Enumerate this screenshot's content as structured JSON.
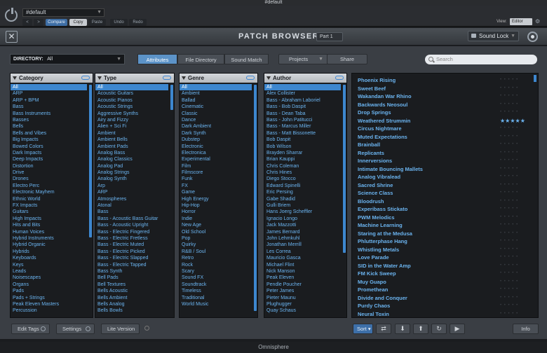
{
  "host": {
    "window_title": "#default",
    "preset_name": "#default",
    "nav_back": "<",
    "nav_forward": ">",
    "buttons": {
      "compare": "Compare",
      "copy": "Copy",
      "paste": "Paste",
      "undo": "Undo",
      "redo": "Redo"
    },
    "view_label": "View:",
    "view_value": "Editor"
  },
  "header": {
    "title": "PATCH BROWSER",
    "part": "Part 1",
    "sound_lock": "Sound Lock"
  },
  "directory": {
    "label": "DIRECTORY:",
    "value": "All"
  },
  "tabs": [
    "Attributes",
    "File Directory",
    "Sound Match"
  ],
  "projects_label": "Projects",
  "share_label": "Share",
  "search_placeholder": "Search",
  "columns": {
    "category": {
      "title": "Category",
      "items": [
        "All",
        "ARP",
        "ARP + BPM",
        "Bass",
        "Bass Instruments",
        "Basses",
        "Bells",
        "Bells and Vibes",
        "Big Impacts",
        "Bowed Colors",
        "Dark Impacts",
        "Deep Impacts",
        "Distortion",
        "Drive",
        "Drones",
        "Electro Perc",
        "Electronic Mayhem",
        "Ethnic World",
        "FX Impacts",
        "Guitars",
        "High Impacts",
        "Hits and Bits",
        "Human Voices",
        "Hybrid Instruments",
        "Hybrid Organic",
        "Hybrids",
        "Keyboards",
        "Keys",
        "Leads",
        "Noisescapes",
        "Organs",
        "Pads",
        "Pads + Strings",
        "Peak Eleven Masters",
        "Percussion"
      ]
    },
    "type": {
      "title": "Type",
      "items": [
        "All",
        "Acoustic Guitars",
        "Acoustic Pianos",
        "Acoustic Strings",
        "Aggressive Synths",
        "Airy and Fizzy",
        "Alien + Sci Fi",
        "Ambient",
        "Ambient Bells",
        "Ambient Pads",
        "Analog Bass",
        "Analog Classics",
        "Analog Pad",
        "Analog Strings",
        "Analog Synth",
        "Arp",
        "ARP",
        "Atmospheres",
        "Atonal",
        "Bass",
        "Bass - Acoustic Bass Guitar",
        "Bass - Acoustic Upright",
        "Bass - Electric Fingered",
        "Bass - Electric Fretless",
        "Bass - Electric Muted",
        "Bass - Electric Picked",
        "Bass - Electric Slapped",
        "Bass - Electric Tapped",
        "Bass Synth",
        "Bell Pads",
        "Bell Textures",
        "Bells Acoustic",
        "Bells Ambient",
        "Bells Analog",
        "Bells Bowls"
      ]
    },
    "genre": {
      "title": "Genre",
      "items": [
        "All",
        "Ambient",
        "Ballad",
        "Cinematic",
        "Classic",
        "Dance",
        "Dark Ambient",
        "Dark Synth",
        "Dubstep",
        "Electronic",
        "Electronica",
        "Experimental",
        "Film",
        "Filmscore",
        "Funk",
        "FX",
        "Game",
        "High Energy",
        "Hip-Hop",
        "Horror",
        "Indie",
        "New Age",
        "Old School",
        "Pop",
        "Quirky",
        "R&B / Soul",
        "Retro",
        "Rock",
        "Scary",
        "Sound FX",
        "Soundtrack",
        "Timeless",
        "Traditional",
        "World Music"
      ]
    },
    "author": {
      "title": "Author",
      "items": [
        "All",
        "Alex Collister",
        "Bass - Abraham Laboriel",
        "Bass - Bob Daspit",
        "Bass - Dean Taba",
        "Bass - John Patitucci",
        "Bass - Marcus Miller",
        "Bass - Matt Bissonette",
        "Bob Daspit",
        "Bob Wilson",
        "Brayden Sharrar",
        "Brian Kauppi",
        "Chris Coleman",
        "Chris Hines",
        "Diego Stocco",
        "Edward Spinelli",
        "Eric Persing",
        "Gabe Shadid",
        "Gulli Briem",
        "Hans Joerg Scheffler",
        "Ignacio Longo",
        "Jack Mazzotti",
        "James Bernard",
        "John Lehmkuhl",
        "Jonathan Merrill",
        "Les Correa",
        "Mauricio Gasca",
        "Michael Flint",
        "Nick Manson",
        "Peak Eleven",
        "Pendle Poucher",
        "Peter James",
        "Pieter Maunu",
        "Plughugger",
        "Quay Schaus"
      ]
    }
  },
  "patches": [
    {
      "name": "Phoenix Rising",
      "rating": 0
    },
    {
      "name": "Sweet Beef",
      "rating": 0
    },
    {
      "name": "Wakandan War Rhino",
      "rating": 0
    },
    {
      "name": "Backwards Neosoul",
      "rating": 0
    },
    {
      "name": "Drop Springs",
      "rating": 0
    },
    {
      "name": "Weathered Strummin",
      "rating": 5
    },
    {
      "name": "Circus Nightmare",
      "rating": 0
    },
    {
      "name": "Muted Expectations",
      "rating": 0
    },
    {
      "name": "Brainball",
      "rating": 0
    },
    {
      "name": "Replicants",
      "rating": 0
    },
    {
      "name": "Innerversions",
      "rating": 0
    },
    {
      "name": "Intimate Bouncing Mallets",
      "rating": 0
    },
    {
      "name": "Analog Vibralead",
      "rating": 0
    },
    {
      "name": "Sacred Shrine",
      "rating": 0
    },
    {
      "name": "Science Class",
      "rating": 0
    },
    {
      "name": "Bloodrush",
      "rating": 0
    },
    {
      "name": "Experibass Stickato",
      "rating": 0
    },
    {
      "name": "PWM Melodics",
      "rating": 0
    },
    {
      "name": "Machine Learning",
      "rating": 0
    },
    {
      "name": "Staring at the Medusa",
      "rating": 0
    },
    {
      "name": "Phlutterphase Hang",
      "rating": 0
    },
    {
      "name": "Whistling Metals",
      "rating": 0
    },
    {
      "name": "Love Parade",
      "rating": 0
    },
    {
      "name": "SID in the Water Amp",
      "rating": 0
    },
    {
      "name": "FM Kick Sweep",
      "rating": 0
    },
    {
      "name": "Muy Guapo",
      "rating": 0
    },
    {
      "name": "Promethean",
      "rating": 0
    },
    {
      "name": "Divide and Conquer",
      "rating": 0
    },
    {
      "name": "Purdy Chaos",
      "rating": 0
    },
    {
      "name": "Neural Toxin",
      "rating": 0
    }
  ],
  "footer": {
    "edit_tags": "Edit Tags",
    "settings": "Settings",
    "lite_version": "Lite Version",
    "sort": "Sort",
    "info": "Info"
  },
  "brand": "Omnisphere",
  "colors": {
    "accent": "#3d87cf",
    "list_text": "#6bb4f0",
    "panel": "#3a3e44"
  }
}
